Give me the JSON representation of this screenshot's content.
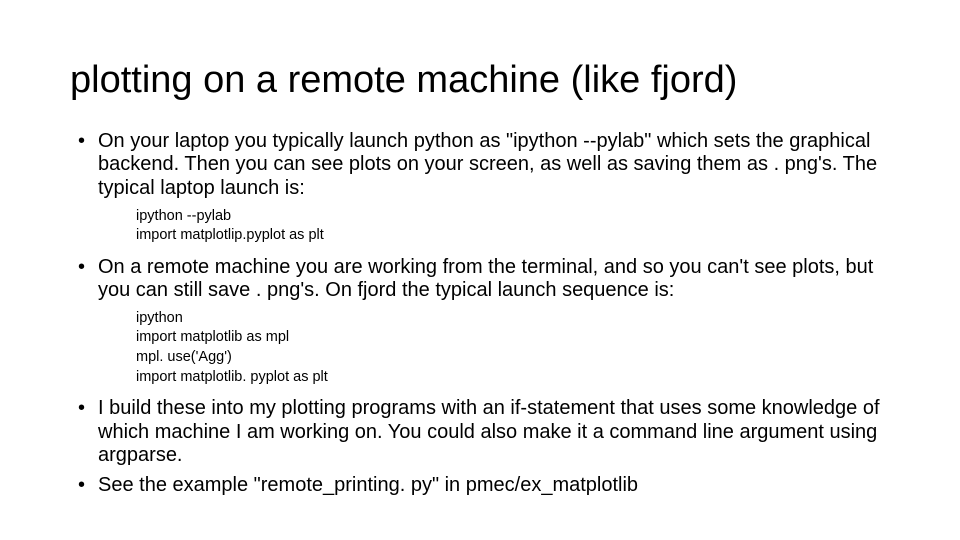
{
  "title": "plotting on a remote machine (like fjord)",
  "bullets": {
    "b1": "On your laptop you typically launch python as \"ipython --pylab\" which sets the graphical backend.  Then you can see plots on your screen, as well as saving them as . png's.  The typical laptop launch is:",
    "b2": "On a remote machine you are working from the terminal, and so you can't see plots, but you can still save . png's.  On fjord the typical launch sequence is:",
    "b3": "I build these into my plotting programs with an if-statement that uses some knowledge of which machine I am working on.  You could also make it a command line argument using argparse.",
    "b4": "See the example \"remote_printing. py\" in pmec/ex_matplotlib"
  },
  "code1": {
    "l1": "ipython --pylab",
    "l2": "import matplotlip.pyplot as plt"
  },
  "code2": {
    "l1": "ipython",
    "l2": "import matplotlib as mpl",
    "l3": "mpl. use('Agg')",
    "l4": "import matplotlib. pyplot as plt"
  }
}
